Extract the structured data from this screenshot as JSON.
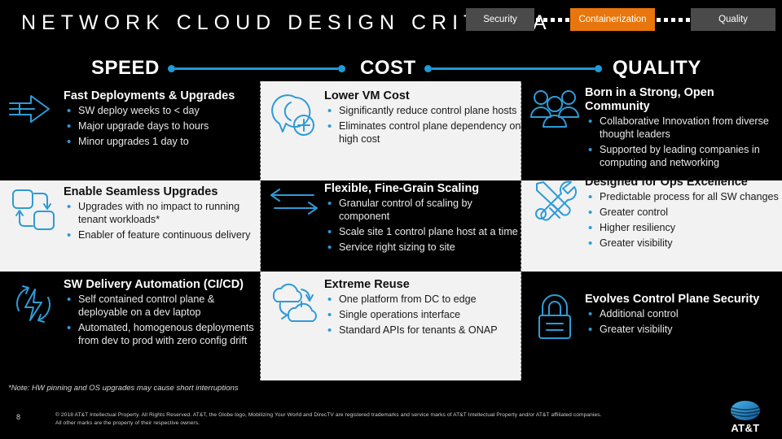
{
  "header": {
    "title": "NETWORK CLOUD DESIGN CRITERIA",
    "pills": [
      {
        "label": "Security",
        "style": "grey",
        "name": "pill-security"
      },
      {
        "label": "Containerization",
        "style": "orange",
        "name": "pill-containerization"
      },
      {
        "label": "Quality",
        "style": "grey",
        "name": "pill-quality"
      }
    ]
  },
  "columns": [
    {
      "heading": "SPEED",
      "blocks": [
        {
          "icon": "fast-arrow-icon",
          "title": "Fast Deployments & Upgrades",
          "bullets": [
            "SW deploy weeks to <  day",
            "Major upgrade days to hours",
            "Minor upgrades 1 day to"
          ]
        },
        {
          "icon": "cycle-squares-icon",
          "title": "Enable Seamless Upgrades",
          "bullets": [
            "Upgrades with no impact to running tenant workloads*",
            "Enabler of feature continuous delivery"
          ]
        },
        {
          "icon": "lightning-refresh-icon",
          "title": "SW Delivery Automation (CI/CD)",
          "bullets": [
            "Self contained control plane & deployable on a dev laptop",
            "Automated, homogenous deployments from dev to prod with zero config drift"
          ]
        }
      ]
    },
    {
      "heading": "COST",
      "blocks": [
        {
          "icon": "location-plus-icon",
          "title": "Lower VM Cost",
          "bullets": [
            "Significantly reduce control plane hosts",
            "Eliminates control plane dependency on high cost"
          ]
        },
        {
          "icon": "bidirectional-arrows-icon",
          "title": "Flexible, Fine-Grain Scaling",
          "bullets": [
            "Granular control of scaling by component",
            "Scale site 1 control plane host at a time",
            "Service right sizing to site"
          ]
        },
        {
          "icon": "cloud-sync-icon",
          "title": "Extreme Reuse",
          "bullets": [
            "One platform from DC to edge",
            "Single operations interface",
            "Standard APIs for tenants & ONAP"
          ]
        }
      ]
    },
    {
      "heading": "QUALITY",
      "blocks": [
        {
          "icon": "people-group-icon",
          "title": "Born in a Strong, Open Community",
          "bullets": [
            "Collaborative Innovation from diverse thought leaders",
            "Supported by leading companies in computing and networking"
          ]
        },
        {
          "icon": "tools-icon",
          "title": "Designed for Ops Excellence",
          "bullets": [
            "Predictable process for all SW changes",
            "Greater control",
            "Higher resiliency",
            "Greater visibility"
          ]
        },
        {
          "icon": "padlock-icon",
          "title": "Evolves Control Plane Security",
          "bullets": [
            "Additional control",
            "Greater visibility"
          ]
        }
      ]
    }
  ],
  "footer": {
    "note": "*Note: HW pinning and OS upgrades may cause short interruptions",
    "page_number": "8",
    "copyright_line1": "© 2018 AT&T Intellectual Property. All Rights Reserved.  AT&T, the Globe logo, Mobilizing Your World and DirecTV are registered trademarks and service marks of AT&T Intellectual Property and/or AT&T affiliated companies.",
    "copyright_line2": "All other marks are the property of their respective owners.",
    "logo_text": "AT&T"
  },
  "colors": {
    "accent_blue": "#1f9bd8",
    "orange": "#e8760c",
    "panel_light": "#f2f2f2",
    "background": "#000000"
  }
}
